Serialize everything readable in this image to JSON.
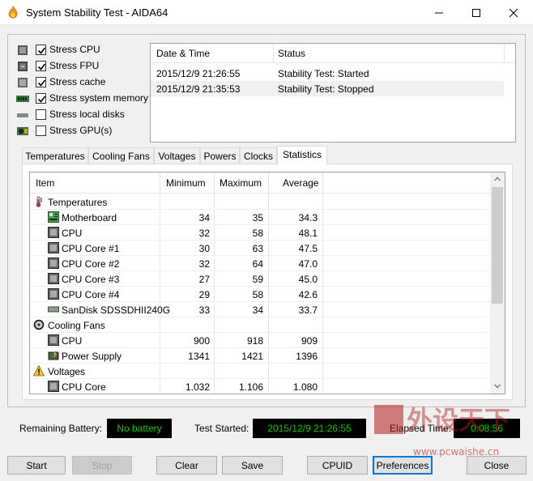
{
  "window": {
    "title": "System Stability Test - AIDA64"
  },
  "stress_options": [
    {
      "label": "Stress CPU",
      "checked": true,
      "icon": "cpu-chip-icon"
    },
    {
      "label": "Stress FPU",
      "checked": true,
      "icon": "fpu-chip-icon"
    },
    {
      "label": "Stress cache",
      "checked": true,
      "icon": "cache-chip-icon"
    },
    {
      "label": "Stress system memory",
      "checked": true,
      "icon": "memory-module-icon"
    },
    {
      "label": "Stress local disks",
      "checked": false,
      "icon": "hard-disk-icon"
    },
    {
      "label": "Stress GPU(s)",
      "checked": false,
      "icon": "gpu-card-icon"
    }
  ],
  "log": {
    "headers": {
      "datetime": "Date & Time",
      "status": "Status"
    },
    "rows": [
      {
        "datetime": "2015/12/9 21:26:55",
        "status": "Stability Test: Started"
      },
      {
        "datetime": "2015/12/9 21:35:53",
        "status": "Stability Test: Stopped"
      }
    ]
  },
  "tabs": [
    "Temperatures",
    "Cooling Fans",
    "Voltages",
    "Powers",
    "Clocks",
    "Statistics"
  ],
  "active_tab": "Statistics",
  "stats": {
    "headers": {
      "item": "Item",
      "min": "Minimum",
      "max": "Maximum",
      "avg": "Average"
    },
    "rows": [
      {
        "kind": "group",
        "name": "Temperatures",
        "icon": "thermometer-icon"
      },
      {
        "kind": "item",
        "name": "Motherboard",
        "min": "34",
        "max": "35",
        "avg": "34.3",
        "icon": "motherboard-icon"
      },
      {
        "kind": "item",
        "name": "CPU",
        "min": "32",
        "max": "58",
        "avg": "48.1",
        "icon": "chip-icon"
      },
      {
        "kind": "item",
        "name": "CPU Core #1",
        "min": "30",
        "max": "63",
        "avg": "47.5",
        "icon": "chip-icon"
      },
      {
        "kind": "item",
        "name": "CPU Core #2",
        "min": "32",
        "max": "64",
        "avg": "47.0",
        "icon": "chip-icon"
      },
      {
        "kind": "item",
        "name": "CPU Core #3",
        "min": "27",
        "max": "59",
        "avg": "45.0",
        "icon": "chip-icon"
      },
      {
        "kind": "item",
        "name": "CPU Core #4",
        "min": "29",
        "max": "58",
        "avg": "42.6",
        "icon": "chip-icon"
      },
      {
        "kind": "item",
        "name": "SanDisk SDSSDHII240G",
        "min": "33",
        "max": "34",
        "avg": "33.7",
        "icon": "disk-drive-icon"
      },
      {
        "kind": "group",
        "name": "Cooling Fans",
        "icon": "fan-icon"
      },
      {
        "kind": "item",
        "name": "CPU",
        "min": "900",
        "max": "918",
        "avg": "909",
        "icon": "chip-icon"
      },
      {
        "kind": "item",
        "name": "Power Supply",
        "min": "1341",
        "max": "1421",
        "avg": "1396",
        "icon": "power-supply-icon"
      },
      {
        "kind": "group",
        "name": "Voltages",
        "icon": "warning-voltage-icon"
      },
      {
        "kind": "item",
        "name": "CPU Core",
        "min": "1.032",
        "max": "1.106",
        "avg": "1.080",
        "icon": "chip-icon"
      }
    ]
  },
  "status_bar": {
    "battery_label": "Remaining Battery:",
    "battery_value": "No battery",
    "started_label": "Test Started:",
    "started_value": "2015/12/9 21:26:55",
    "elapsed_label": "Elapsed Time:",
    "elapsed_value": "0:08:56"
  },
  "buttons": {
    "start": "Start",
    "stop": "Stop",
    "clear": "Clear",
    "save": "Save",
    "cpuid": "CPUID",
    "preferences": "Preferences",
    "close": "Close"
  },
  "watermark": {
    "text": "外设天下",
    "url": "www.pcwaishe.cn"
  },
  "colors": {
    "status_bg": "#000000",
    "status_text": "#00d000",
    "focus": "#0078d7"
  }
}
